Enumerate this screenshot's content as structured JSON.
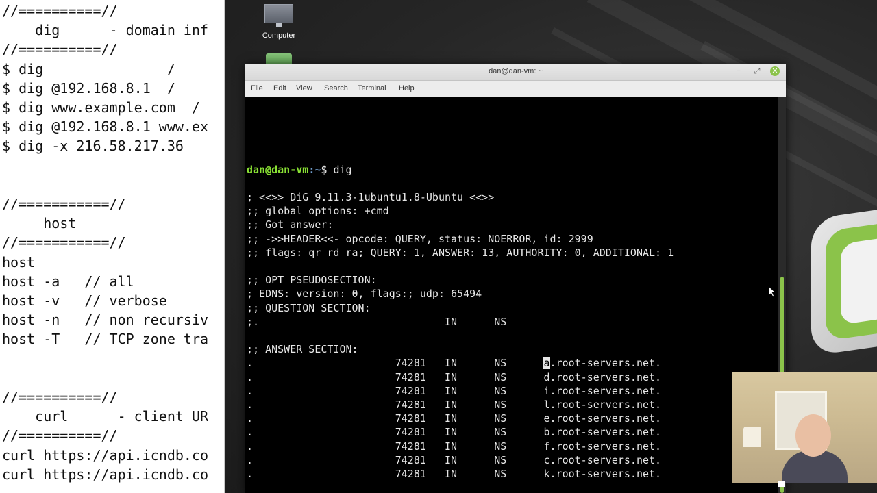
{
  "notes": {
    "lines": [
      "//==========//",
      "    dig      - domain inf",
      "//==========//",
      "$ dig               /",
      "$ dig @192.168.8.1  /",
      "$ dig www.example.com  /",
      "$ dig @192.168.8.1 www.ex",
      "$ dig -x 216.58.217.36",
      "",
      "",
      "//===========//",
      "     host",
      "//===========//",
      "host",
      "host -a   // all",
      "host -v   // verbose",
      "host -n   // non recursiv",
      "host -T   // TCP zone tra",
      "",
      "",
      "//==========//",
      "    curl      - client UR",
      "//==========//",
      "curl https://api.icndb.co",
      "curl https://api.icndb.co"
    ]
  },
  "desktop": {
    "icons": [
      {
        "label": "Computer",
        "icon": "computer-icon"
      },
      {
        "label": "",
        "icon": "folder-icon"
      }
    ]
  },
  "terminal": {
    "title": "dan@dan-vm: ~",
    "menu": [
      "File",
      "Edit",
      "View",
      "Search",
      "Terminal",
      "Help"
    ],
    "buttons": {
      "minimize": "−",
      "maximize": "⤢",
      "close": "✕"
    },
    "prompt": {
      "user": "dan@dan-vm",
      "path": ":~",
      "symbol": "$ ",
      "command": "dig"
    },
    "output": [
      "; <<>> DiG 9.11.3-1ubuntu1.8-Ubuntu <<>>",
      ";; global options: +cmd",
      ";; Got answer:",
      ";; ->>HEADER<<- opcode: QUERY, status: NOERROR, id: 2999",
      ";; flags: qr rd ra; QUERY: 1, ANSWER: 13, AUTHORITY: 0, ADDITIONAL: 1",
      "",
      ";; OPT PSEUDOSECTION:",
      "; EDNS: version: 0, flags:; udp: 65494",
      ";; QUESTION SECTION:",
      ";.                              IN      NS",
      "",
      ";; ANSWER SECTION:"
    ],
    "answers": [
      {
        "name": ".",
        "ttl": "74281",
        "class": "IN",
        "type": "NS",
        "first": "a",
        "rest": ".root-servers.net."
      },
      {
        "name": ".",
        "ttl": "74281",
        "class": "IN",
        "type": "NS",
        "first": "d",
        "rest": ".root-servers.net."
      },
      {
        "name": ".",
        "ttl": "74281",
        "class": "IN",
        "type": "NS",
        "first": "i",
        "rest": ".root-servers.net."
      },
      {
        "name": ".",
        "ttl": "74281",
        "class": "IN",
        "type": "NS",
        "first": "l",
        "rest": ".root-servers.net."
      },
      {
        "name": ".",
        "ttl": "74281",
        "class": "IN",
        "type": "NS",
        "first": "e",
        "rest": ".root-servers.net."
      },
      {
        "name": ".",
        "ttl": "74281",
        "class": "IN",
        "type": "NS",
        "first": "b",
        "rest": ".root-servers.net."
      },
      {
        "name": ".",
        "ttl": "74281",
        "class": "IN",
        "type": "NS",
        "first": "f",
        "rest": ".root-servers.net."
      },
      {
        "name": ".",
        "ttl": "74281",
        "class": "IN",
        "type": "NS",
        "first": "c",
        "rest": ".root-servers.net."
      },
      {
        "name": ".",
        "ttl": "74281",
        "class": "IN",
        "type": "NS",
        "first": "k",
        "rest": ".root-servers.net."
      }
    ]
  },
  "colors": {
    "accent": "#8bc34a",
    "prompt_user": "#8ae234",
    "prompt_path": "#729fcf"
  }
}
